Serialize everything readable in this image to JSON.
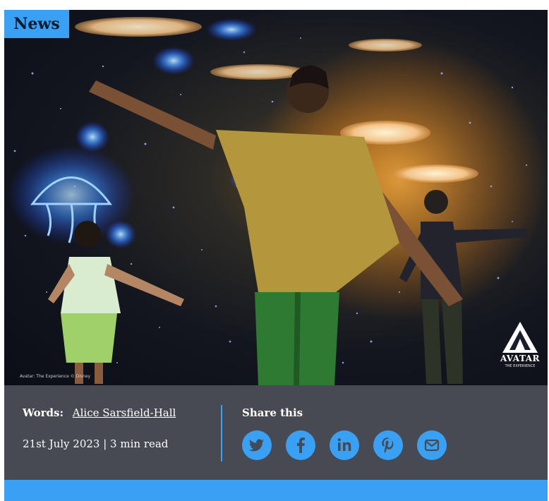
{
  "article": {
    "section_tag": "News",
    "photo_credit": "Avatar: The Experience © Disney",
    "logo": {
      "word": "AVATAR",
      "sub": "THE EXPERIENCE"
    },
    "byline_label": "Words:",
    "author": "Alice Sarsfield-Hall",
    "date_readtime": "21st July 2023 | 3 min read"
  },
  "share": {
    "label": "Share this",
    "buttons": [
      {
        "icon": "twitter-icon"
      },
      {
        "icon": "facebook-icon"
      },
      {
        "icon": "linkedin-icon"
      },
      {
        "icon": "pinterest-icon"
      },
      {
        "icon": "email-icon"
      }
    ]
  },
  "colors": {
    "accent": "#3aa0f3",
    "info_bg": "#474a52",
    "icon_glyph": "#474a52"
  }
}
